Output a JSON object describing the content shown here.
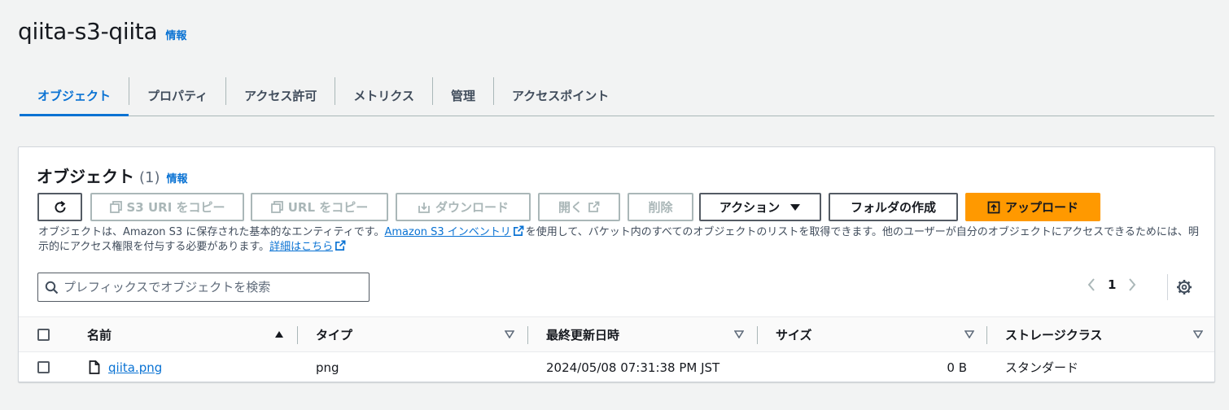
{
  "header": {
    "title": "qiita-s3-qiita",
    "info": "情報"
  },
  "tabs": [
    {
      "label": "オブジェクト",
      "active": true
    },
    {
      "label": "プロパティ"
    },
    {
      "label": "アクセス許可"
    },
    {
      "label": "メトリクス"
    },
    {
      "label": "管理"
    },
    {
      "label": "アクセスポイント"
    }
  ],
  "panel": {
    "title": "オブジェクト",
    "count": "(1)",
    "info": "情報"
  },
  "toolbar": {
    "refresh_icon": "refresh-icon",
    "copy_s3_uri": "S3 URI をコピー",
    "copy_url": "URL をコピー",
    "download": "ダウンロード",
    "open": "開く",
    "delete": "削除",
    "actions": "アクション",
    "create_folder": "フォルダの作成",
    "upload": "アップロード"
  },
  "description": {
    "part1": "オブジェクトは、Amazon S3 に保存された基本的なエンティティです。",
    "link1": "Amazon S3 インベントリ",
    "part2": "を使用して、バケット内のすべてのオブジェクトのリストを取得できます。他のユーザーが自分のオブジェクトにアクセスできるためには、明示的にアクセス権限を付与する必要があります。",
    "link2": "詳細はこちら"
  },
  "search": {
    "placeholder": "プレフィックスでオブジェクトを検索",
    "value": ""
  },
  "pagination": {
    "current_page": "1"
  },
  "table": {
    "columns": {
      "name": "名前",
      "type": "タイプ",
      "modified": "最終更新日時",
      "size": "サイズ",
      "storage_class": "ストレージクラス"
    },
    "rows": [
      {
        "name": "qiita.png",
        "type": "png",
        "modified": "2024/05/08 07:31:38 PM JST",
        "size": "0 B",
        "storage_class": "スタンダード"
      }
    ]
  },
  "colors": {
    "accent": "#0972d3",
    "primary_button": "#ff9900",
    "disabled": "#aab7b8"
  }
}
